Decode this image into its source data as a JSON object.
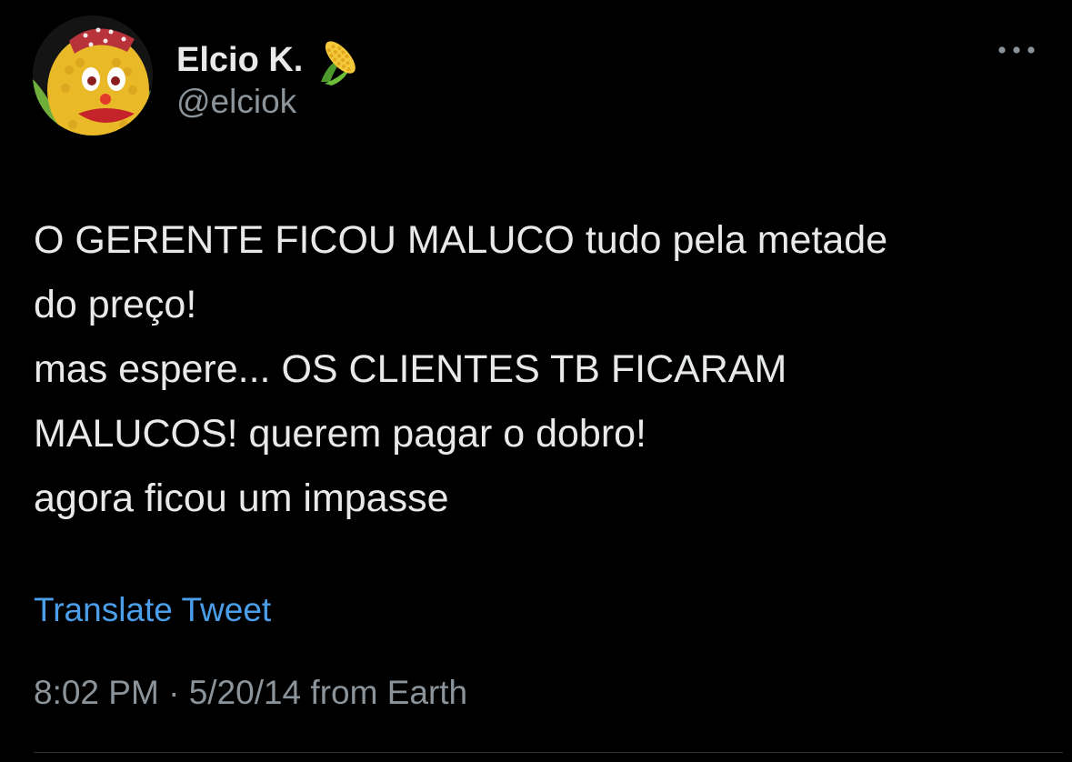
{
  "tweet": {
    "author": {
      "display_name": "Elcio K.",
      "emoji_icon": "corn-icon",
      "handle": "@elciok",
      "avatar_icon": "corn-character-avatar"
    },
    "more_icon": "more-dots-icon",
    "text_lines": [
      "O GERENTE FICOU MALUCO tudo pela metade",
      "do preço!",
      "mas espere... OS CLIENTES TB FICARAM",
      "MALUCOS! querem pagar o dobro!",
      "agora ficou um impasse"
    ],
    "translate_label": "Translate Tweet",
    "time": "8:02 PM",
    "separator": "·",
    "date": "5/20/14",
    "source": "from Earth"
  },
  "colors": {
    "background": "#000000",
    "primary_text": "#e7e9ea",
    "secondary_text": "#8b949a",
    "link": "#4a9eea"
  }
}
